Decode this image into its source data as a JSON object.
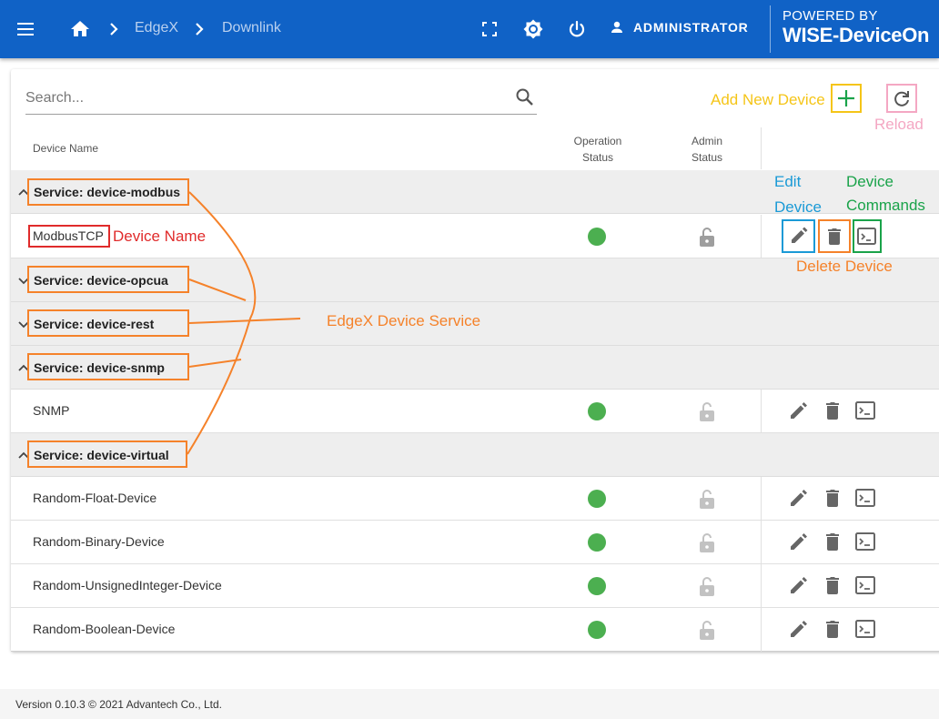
{
  "header": {
    "breadcrumb": [
      "EdgeX",
      "Downlink"
    ],
    "user": "ADMINISTRATOR",
    "powered_by": "POWERED BY",
    "brand": "WISE-DeviceOn"
  },
  "search": {
    "placeholder": "Search..."
  },
  "columns": {
    "device_name": "Device Name",
    "operation_status_1": "Operation",
    "operation_status_2": "Status",
    "admin_status_1": "Admin",
    "admin_status_2": "Status"
  },
  "groups": [
    {
      "title": "Service: device-modbus",
      "expanded": true,
      "devices": [
        "ModbusTCP"
      ]
    },
    {
      "title": "Service: device-opcua",
      "expanded": false,
      "devices": []
    },
    {
      "title": "Service: device-rest",
      "expanded": false,
      "devices": []
    },
    {
      "title": "Service: device-snmp",
      "expanded": true,
      "devices": [
        "SNMP"
      ]
    },
    {
      "title": "Service: device-virtual",
      "expanded": true,
      "devices": [
        "Random-Float-Device",
        "Random-Binary-Device",
        "Random-UnsignedInteger-Device",
        "Random-Boolean-Device"
      ]
    }
  ],
  "annotations": {
    "add_new_device": "Add New Device",
    "reload": "Reload",
    "edit_device_1": "Edit",
    "edit_device_2": "Device",
    "device_commands_1": "Device",
    "device_commands_2": "Commands",
    "delete_device": "Delete Device",
    "device_name": "Device Name",
    "edgex_device_service": "EdgeX Device Service"
  },
  "colors": {
    "appbar": "#1062c6",
    "status_ok": "#4caf50",
    "ann_orange": "#f5822a",
    "ann_red": "#e02b2b",
    "ann_yellow": "#f5c518",
    "ann_pink": "#f4a7c3",
    "ann_blue": "#1a9ad6",
    "ann_green": "#1aa34a"
  },
  "footer": {
    "text": "Version 0.10.3 © 2021 Advantech Co., Ltd."
  }
}
